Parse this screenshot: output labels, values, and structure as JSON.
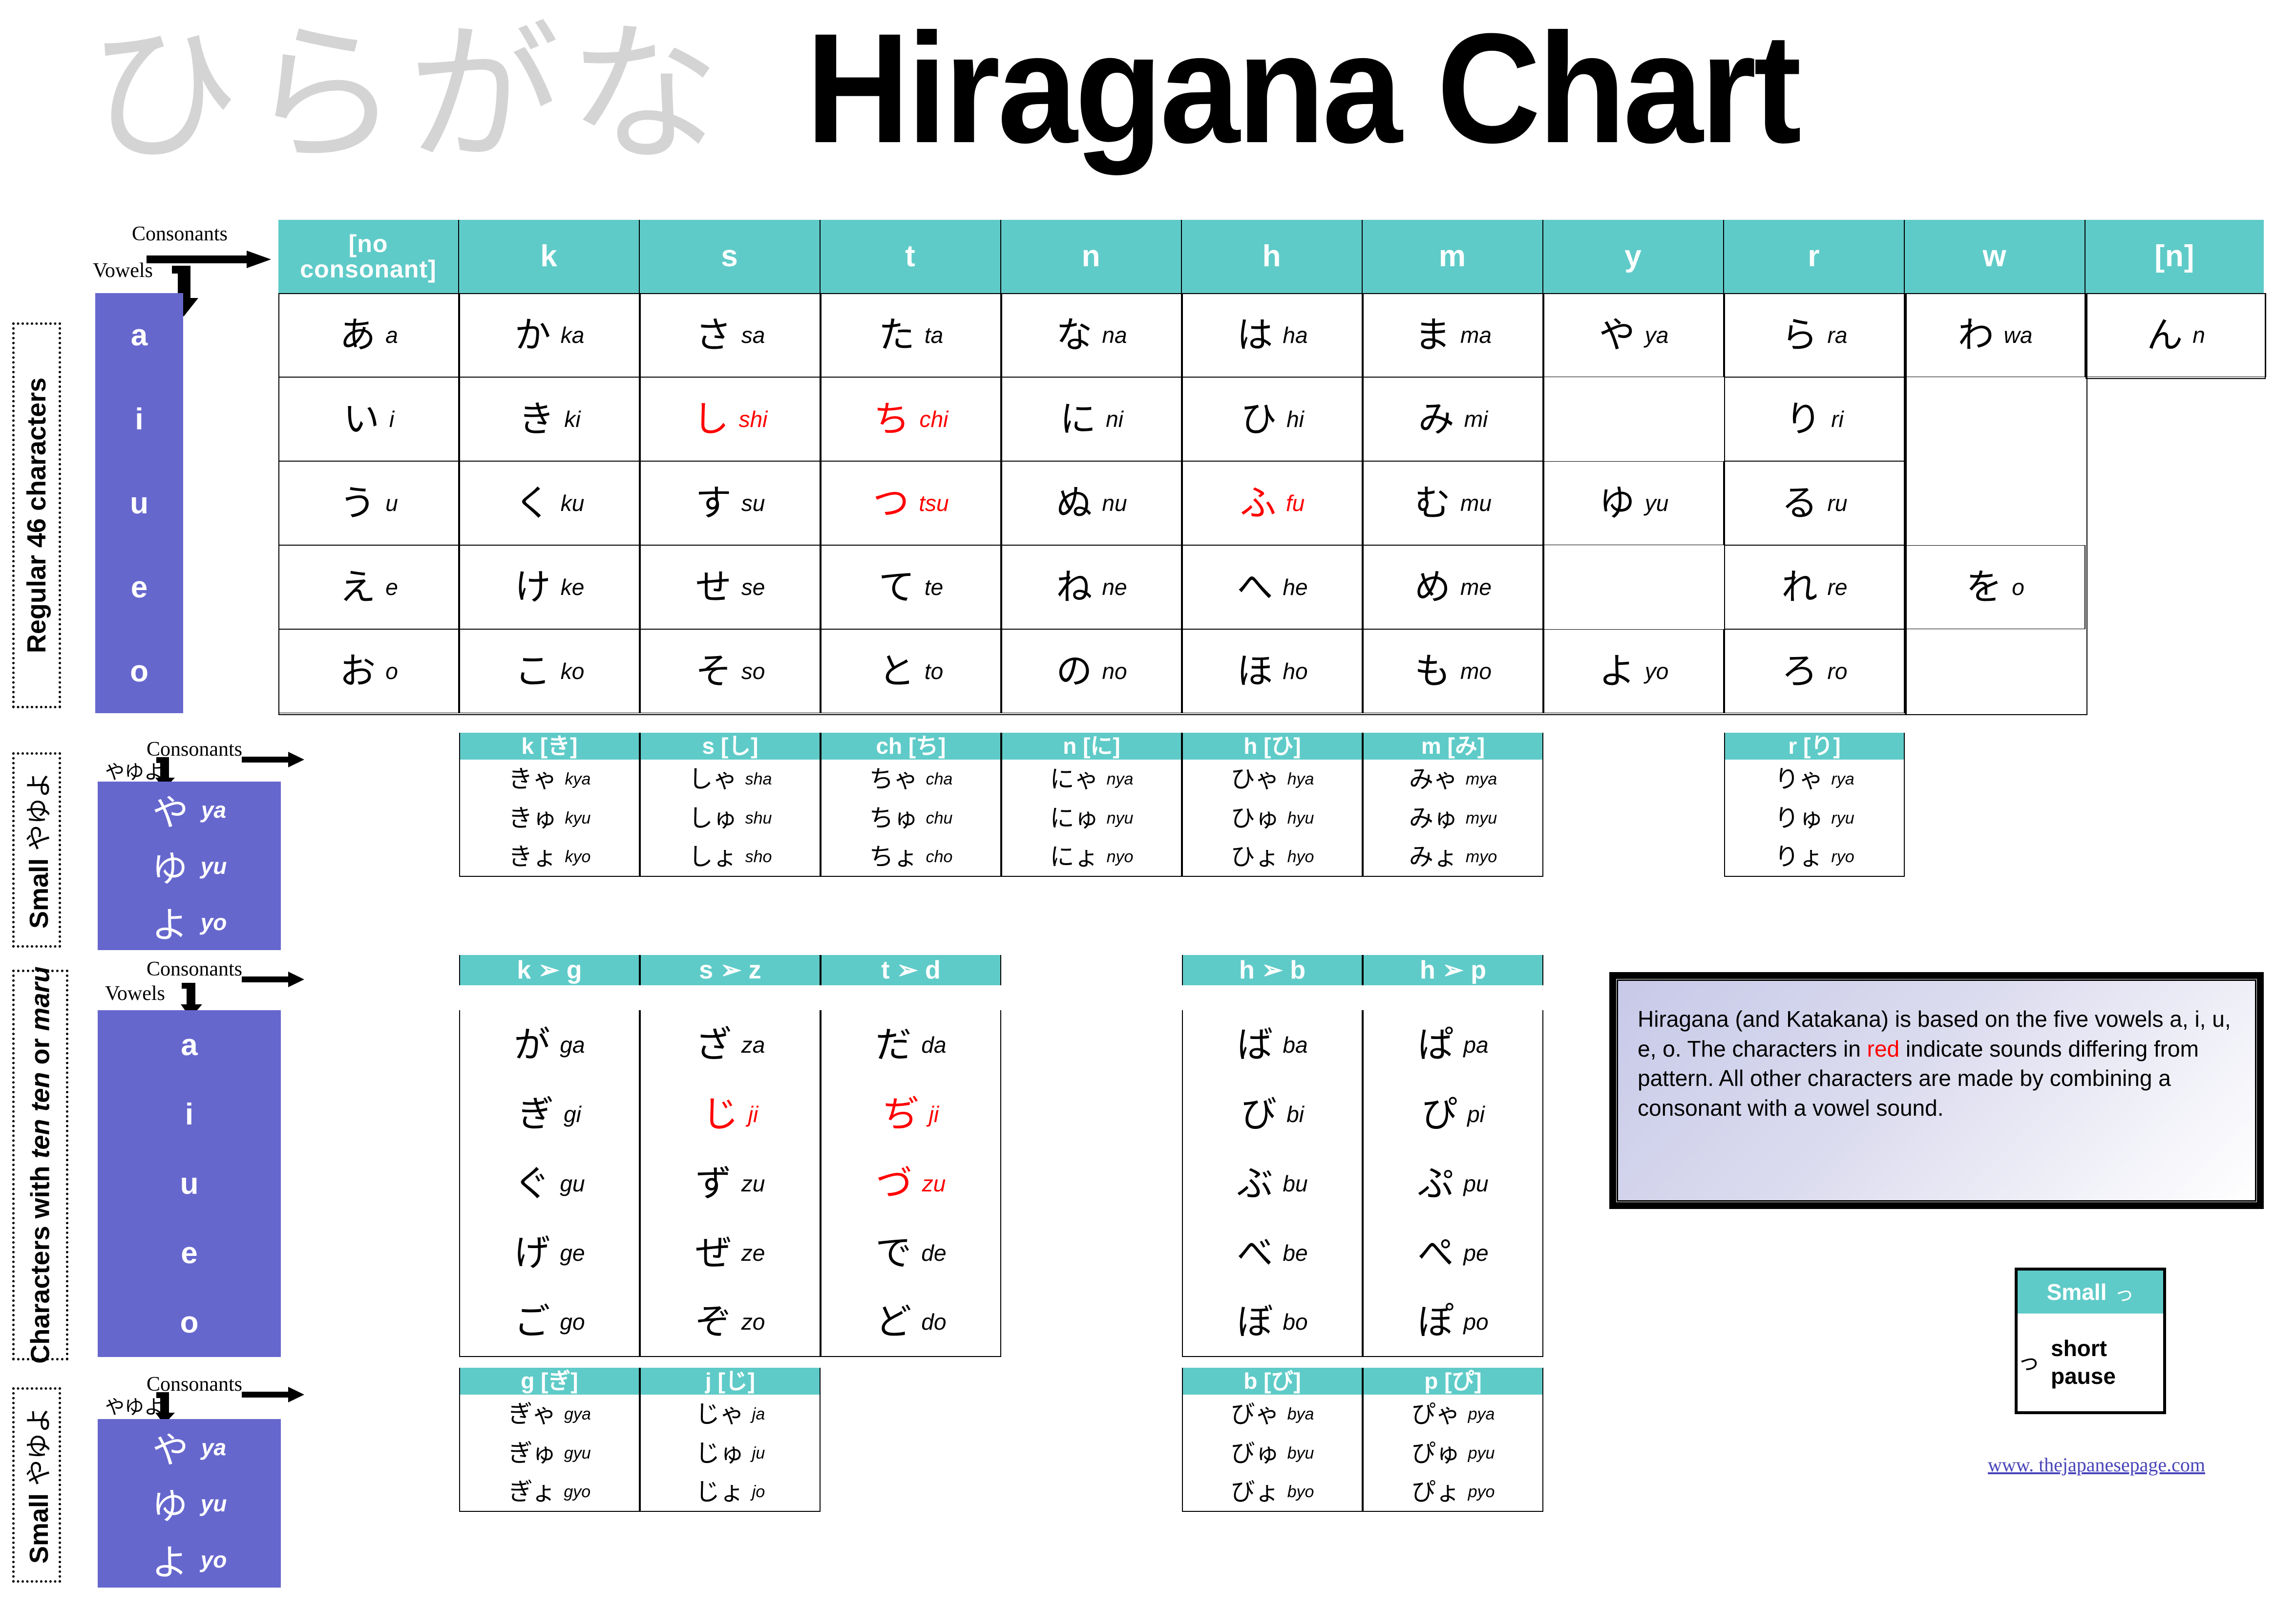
{
  "watermark": "ひらがな",
  "title": "Hiragana Chart",
  "colors": {
    "teal": "#5fcbc8",
    "purple": "#6667cd",
    "red": "#ff0000",
    "link": "#4a46b9"
  },
  "annotations": {
    "consonants": "Consonants",
    "vowels": "Vowels",
    "small_yayuyo_kana": "やゆよ"
  },
  "side_labels": {
    "regular": "Regular 46 characters",
    "small_yayuyo_top": "Small やゆよ",
    "ten_ten": "Characters with ten ten or maru",
    "small_yayuyo_bottom": "Small やゆよ"
  },
  "main_table": {
    "column_headers": [
      "[no consonant]",
      "k",
      "s",
      "t",
      "n",
      "h",
      "m",
      "y",
      "r",
      "w",
      "[n]"
    ],
    "row_headers": [
      "a",
      "i",
      "u",
      "e",
      "o"
    ],
    "rows": [
      [
        {
          "kana": "あ",
          "romaji": "a",
          "red": false
        },
        {
          "kana": "か",
          "romaji": "ka",
          "red": false
        },
        {
          "kana": "さ",
          "romaji": "sa",
          "red": false
        },
        {
          "kana": "た",
          "romaji": "ta",
          "red": false
        },
        {
          "kana": "な",
          "romaji": "na",
          "red": false
        },
        {
          "kana": "は",
          "romaji": "ha",
          "red": false
        },
        {
          "kana": "ま",
          "romaji": "ma",
          "red": false
        },
        {
          "kana": "や",
          "romaji": "ya",
          "red": false
        },
        {
          "kana": "ら",
          "romaji": "ra",
          "red": false
        },
        {
          "kana": "わ",
          "romaji": "wa",
          "red": false
        },
        {
          "kana": "ん",
          "romaji": "n",
          "red": false
        }
      ],
      [
        {
          "kana": "い",
          "romaji": "i",
          "red": false
        },
        {
          "kana": "き",
          "romaji": "ki",
          "red": false
        },
        {
          "kana": "し",
          "romaji": "shi",
          "red": true
        },
        {
          "kana": "ち",
          "romaji": "chi",
          "red": true
        },
        {
          "kana": "に",
          "romaji": "ni",
          "red": false
        },
        {
          "kana": "ひ",
          "romaji": "hi",
          "red": false
        },
        {
          "kana": "み",
          "romaji": "mi",
          "red": false
        },
        {
          "kana": "",
          "romaji": "",
          "red": false
        },
        {
          "kana": "り",
          "romaji": "ri",
          "red": false
        },
        {
          "kana": "",
          "romaji": "",
          "red": false
        },
        {
          "kana": "",
          "romaji": "",
          "red": false
        }
      ],
      [
        {
          "kana": "う",
          "romaji": "u",
          "red": false
        },
        {
          "kana": "く",
          "romaji": "ku",
          "red": false
        },
        {
          "kana": "す",
          "romaji": "su",
          "red": false
        },
        {
          "kana": "つ",
          "romaji": "tsu",
          "red": true
        },
        {
          "kana": "ぬ",
          "romaji": "nu",
          "red": false
        },
        {
          "kana": "ふ",
          "romaji": "fu",
          "red": true
        },
        {
          "kana": "む",
          "romaji": "mu",
          "red": false
        },
        {
          "kana": "ゆ",
          "romaji": "yu",
          "red": false
        },
        {
          "kana": "る",
          "romaji": "ru",
          "red": false
        },
        {
          "kana": "",
          "romaji": "",
          "red": false
        },
        {
          "kana": "",
          "romaji": "",
          "red": false
        }
      ],
      [
        {
          "kana": "え",
          "romaji": "e",
          "red": false
        },
        {
          "kana": "け",
          "romaji": "ke",
          "red": false
        },
        {
          "kana": "せ",
          "romaji": "se",
          "red": false
        },
        {
          "kana": "て",
          "romaji": "te",
          "red": false
        },
        {
          "kana": "ね",
          "romaji": "ne",
          "red": false
        },
        {
          "kana": "へ",
          "romaji": "he",
          "red": false
        },
        {
          "kana": "め",
          "romaji": "me",
          "red": false
        },
        {
          "kana": "",
          "romaji": "",
          "red": false
        },
        {
          "kana": "れ",
          "romaji": "re",
          "red": false
        },
        {
          "kana": "を",
          "romaji": "o",
          "red": false
        },
        {
          "kana": "",
          "romaji": "",
          "red": false
        }
      ],
      [
        {
          "kana": "お",
          "romaji": "o",
          "red": false
        },
        {
          "kana": "こ",
          "romaji": "ko",
          "red": false
        },
        {
          "kana": "そ",
          "romaji": "so",
          "red": false
        },
        {
          "kana": "と",
          "romaji": "to",
          "red": false
        },
        {
          "kana": "の",
          "romaji": "no",
          "red": false
        },
        {
          "kana": "ほ",
          "romaji": "ho",
          "red": false
        },
        {
          "kana": "も",
          "romaji": "mo",
          "red": false
        },
        {
          "kana": "よ",
          "romaji": "yo",
          "red": false
        },
        {
          "kana": "ろ",
          "romaji": "ro",
          "red": false
        },
        {
          "kana": "",
          "romaji": "",
          "red": false
        },
        {
          "kana": "",
          "romaji": "",
          "red": false
        }
      ]
    ]
  },
  "small_yayuyo_top": [
    {
      "kana": "や",
      "romaji": "ya"
    },
    {
      "kana": "ゆ",
      "romaji": "yu"
    },
    {
      "kana": "よ",
      "romaji": "yo"
    }
  ],
  "small_yayuyo_bottom": [
    {
      "kana": "や",
      "romaji": "ya"
    },
    {
      "kana": "ゆ",
      "romaji": "yu"
    },
    {
      "kana": "よ",
      "romaji": "yo"
    }
  ],
  "yoon_plain": {
    "headers": [
      "k [き]",
      "s [し]",
      "ch [ち]",
      "n [に]",
      "h [ひ]",
      "m [み]",
      "r [り]"
    ],
    "columns": [
      [
        {
          "kana": "きゃ",
          "romaji": "kya"
        },
        {
          "kana": "きゅ",
          "romaji": "kyu"
        },
        {
          "kana": "きょ",
          "romaji": "kyo"
        }
      ],
      [
        {
          "kana": "しゃ",
          "romaji": "sha"
        },
        {
          "kana": "しゅ",
          "romaji": "shu"
        },
        {
          "kana": "しょ",
          "romaji": "sho"
        }
      ],
      [
        {
          "kana": "ちゃ",
          "romaji": "cha"
        },
        {
          "kana": "ちゅ",
          "romaji": "chu"
        },
        {
          "kana": "ちょ",
          "romaji": "cho"
        }
      ],
      [
        {
          "kana": "にゃ",
          "romaji": "nya"
        },
        {
          "kana": "にゅ",
          "romaji": "nyu"
        },
        {
          "kana": "にょ",
          "romaji": "nyo"
        }
      ],
      [
        {
          "kana": "ひゃ",
          "romaji": "hya"
        },
        {
          "kana": "ひゅ",
          "romaji": "hyu"
        },
        {
          "kana": "ひょ",
          "romaji": "hyo"
        }
      ],
      [
        {
          "kana": "みゃ",
          "romaji": "mya"
        },
        {
          "kana": "みゅ",
          "romaji": "myu"
        },
        {
          "kana": "みょ",
          "romaji": "myo"
        }
      ],
      [
        {
          "kana": "りゃ",
          "romaji": "rya"
        },
        {
          "kana": "りゅ",
          "romaji": "ryu"
        },
        {
          "kana": "りょ",
          "romaji": "ryo"
        }
      ]
    ]
  },
  "dakuten": {
    "headers": [
      "k ➢ g",
      "s ➢ z",
      "t ➢ d",
      "h ➢ b",
      "h ➢ p"
    ],
    "vowel_rows": [
      "a",
      "i",
      "u",
      "e",
      "o"
    ],
    "columns": [
      [
        {
          "kana": "が",
          "romaji": "ga",
          "red": false
        },
        {
          "kana": "ぎ",
          "romaji": "gi",
          "red": false
        },
        {
          "kana": "ぐ",
          "romaji": "gu",
          "red": false
        },
        {
          "kana": "げ",
          "romaji": "ge",
          "red": false
        },
        {
          "kana": "ご",
          "romaji": "go",
          "red": false
        }
      ],
      [
        {
          "kana": "ざ",
          "romaji": "za",
          "red": false
        },
        {
          "kana": "じ",
          "romaji": "ji",
          "red": true
        },
        {
          "kana": "ず",
          "romaji": "zu",
          "red": false
        },
        {
          "kana": "ぜ",
          "romaji": "ze",
          "red": false
        },
        {
          "kana": "ぞ",
          "romaji": "zo",
          "red": false
        }
      ],
      [
        {
          "kana": "だ",
          "romaji": "da",
          "red": false
        },
        {
          "kana": "ぢ",
          "romaji": "ji",
          "red": true
        },
        {
          "kana": "づ",
          "romaji": "zu",
          "red": true
        },
        {
          "kana": "で",
          "romaji": "de",
          "red": false
        },
        {
          "kana": "ど",
          "romaji": "do",
          "red": false
        }
      ],
      [
        {
          "kana": "ば",
          "romaji": "ba",
          "red": false
        },
        {
          "kana": "び",
          "romaji": "bi",
          "red": false
        },
        {
          "kana": "ぶ",
          "romaji": "bu",
          "red": false
        },
        {
          "kana": "べ",
          "romaji": "be",
          "red": false
        },
        {
          "kana": "ぼ",
          "romaji": "bo",
          "red": false
        }
      ],
      [
        {
          "kana": "ぱ",
          "romaji": "pa",
          "red": false
        },
        {
          "kana": "ぴ",
          "romaji": "pi",
          "red": false
        },
        {
          "kana": "ぷ",
          "romaji": "pu",
          "red": false
        },
        {
          "kana": "ぺ",
          "romaji": "pe",
          "red": false
        },
        {
          "kana": "ぽ",
          "romaji": "po",
          "red": false
        }
      ]
    ]
  },
  "yoon_dakuten": {
    "headers": [
      "g [ぎ]",
      "j [じ]",
      "b [び]",
      "p [ぴ]"
    ],
    "columns": [
      [
        {
          "kana": "ぎゃ",
          "romaji": "gya"
        },
        {
          "kana": "ぎゅ",
          "romaji": "gyu"
        },
        {
          "kana": "ぎょ",
          "romaji": "gyo"
        }
      ],
      [
        {
          "kana": "じゃ",
          "romaji": "ja"
        },
        {
          "kana": "じゅ",
          "romaji": "ju"
        },
        {
          "kana": "じょ",
          "romaji": "jo"
        }
      ],
      [
        {
          "kana": "びゃ",
          "romaji": "bya"
        },
        {
          "kana": "びゅ",
          "romaji": "byu"
        },
        {
          "kana": "びょ",
          "romaji": "byo"
        }
      ],
      [
        {
          "kana": "ぴゃ",
          "romaji": "pya"
        },
        {
          "kana": "ぴゅ",
          "romaji": "pyu"
        },
        {
          "kana": "ぴょ",
          "romaji": "pyo"
        }
      ]
    ]
  },
  "info_box": {
    "part1": "Hiragana (and Katakana) is based on the five vowels a, i, u, e, o.   The characters in ",
    "red_word": "red",
    "part2": " indicate sounds differing from pattern.  All other characters are made by combining a consonant with a vowel sound."
  },
  "small_tsu_box": {
    "header_label": "Small",
    "header_kana": "っ",
    "body_kana": "っ",
    "body_text": "short pause"
  },
  "url": "www. thejapanesepage.com"
}
